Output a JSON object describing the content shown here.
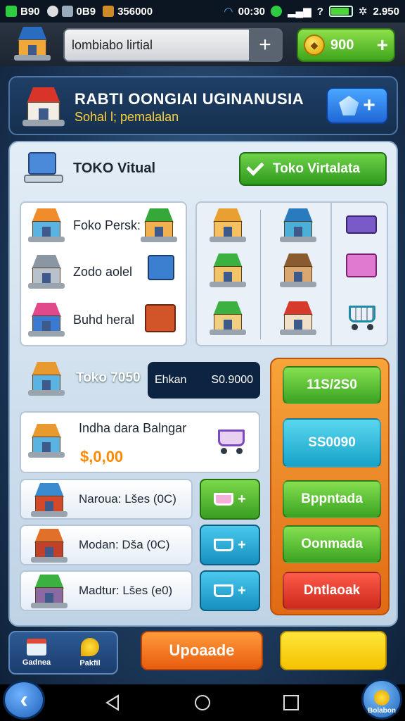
{
  "status_bar": {
    "left_text": "B90",
    "mid_text": "0B9",
    "chip_text": "356000",
    "time": "00:30",
    "signal_text": "?",
    "battery_level": 0.85,
    "right_text": "2.950"
  },
  "top_bar": {
    "search_value": "lombiabo lirtial",
    "coin_amount": "900",
    "plus_symbol": "+"
  },
  "header": {
    "title": "RABTI OONGIAI UGINANUSIA",
    "subtitle": "Sohal l; pemalalan"
  },
  "store": {
    "title": "TOKO Vitual",
    "primary_button": "Toko Virtalata",
    "list_items": [
      "Foko Persk:",
      "Zodo aolel",
      "Buhd heral"
    ],
    "store_name": "Toko 7050",
    "chip_label": "Ehkan",
    "chip_value": "S0.9000"
  },
  "promo": {
    "title": "Indha dara Balngar",
    "price": "$,0,00"
  },
  "items": [
    {
      "label": "Naroua: Lšes (0C)"
    },
    {
      "label": "Modan: Dša (0C)"
    },
    {
      "label": "Madtur: Lšes (e0)"
    }
  ],
  "side_buttons": [
    "11S/2S0",
    "SS0090",
    "Bppntada",
    "Oonmada",
    "Dntlaoak"
  ],
  "bottom": {
    "tab1": "Gadnea",
    "tab2": "Pakfil",
    "update": "Upoaade",
    "profile": "Bolabon"
  },
  "colors": {
    "accent_green": "#3fa41c",
    "accent_orange": "#e06a14",
    "panel_blue": "#16304f"
  }
}
